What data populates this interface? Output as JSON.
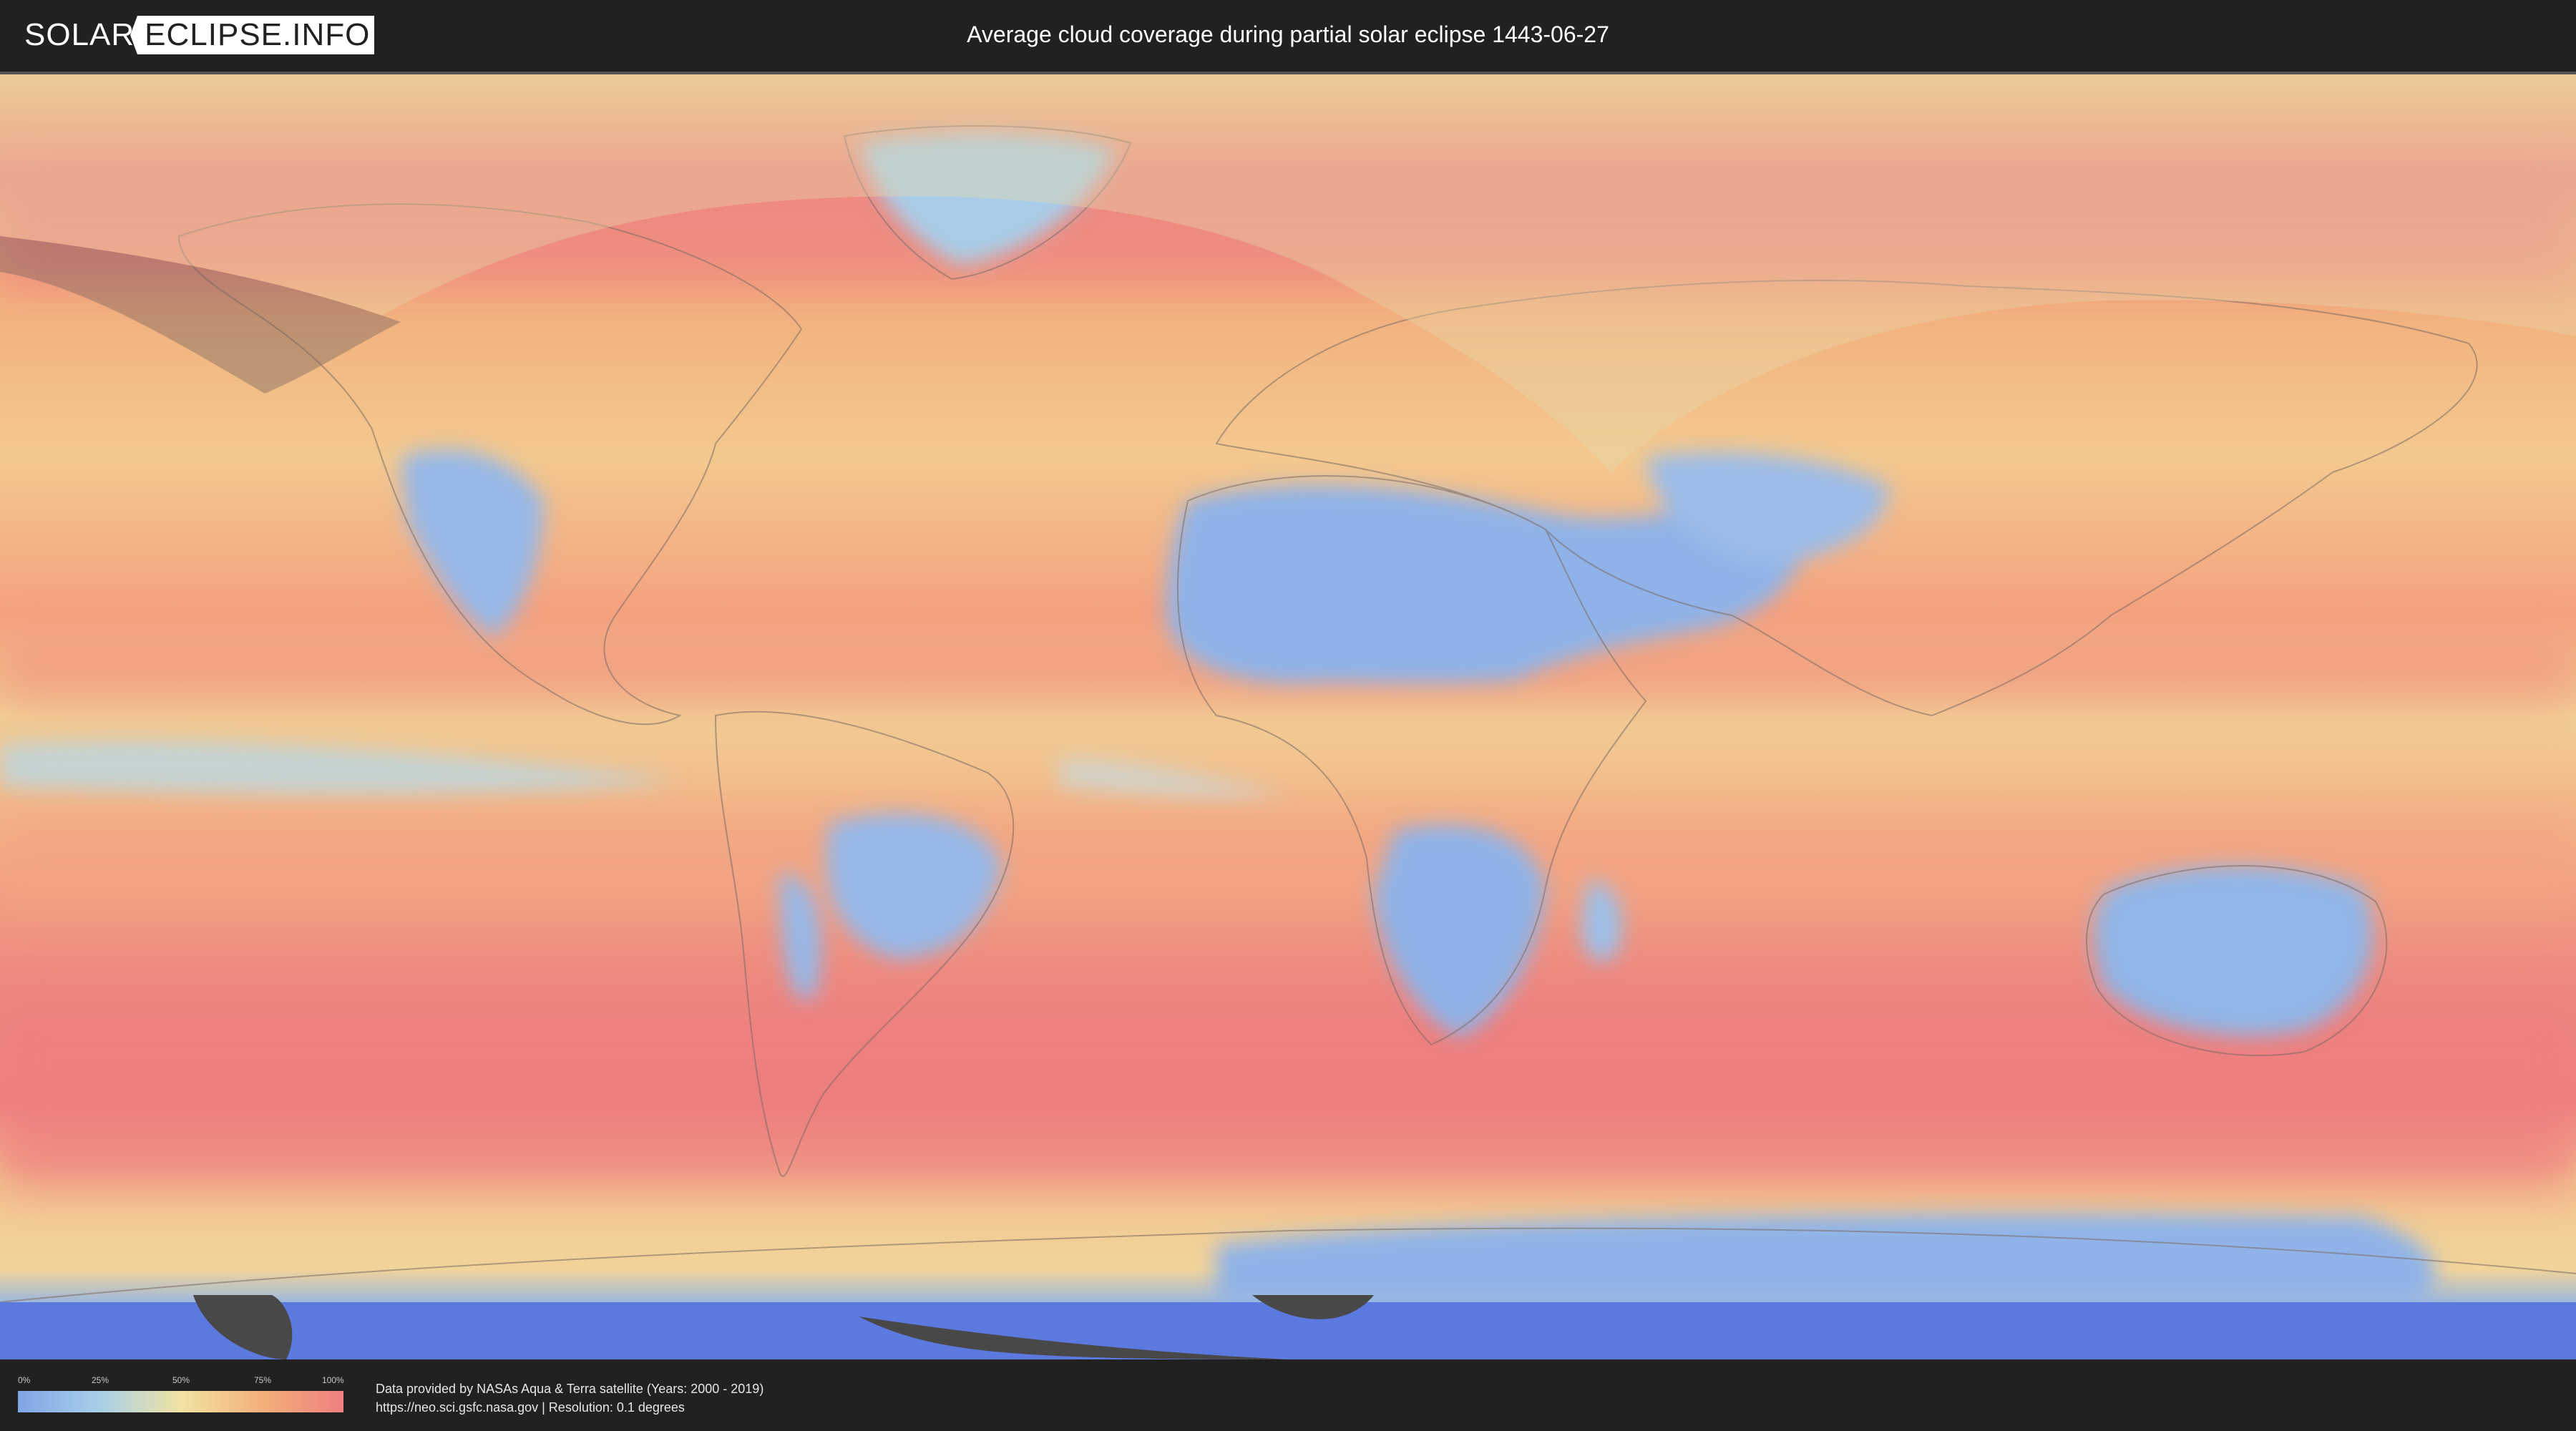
{
  "header": {
    "logo_part1": "SOLAR",
    "logo_part2": "ECLIPSE.INFO",
    "title": "Average cloud coverage during partial solar eclipse 1443-06-27"
  },
  "map": {
    "colors": {
      "cloudy": "#ee7f7f",
      "mid": "#f1e3a3",
      "clear": "#8fb3e8",
      "polar": "#5b79df",
      "eclipse_shade": "#e8d8a8"
    }
  },
  "legend": {
    "ticks": [
      "0%",
      "25%",
      "50%",
      "75%",
      "100%"
    ]
  },
  "credits": {
    "line1": "Data provided by NASAs Aqua & Terra satellite (Years: 2000 - 2019)",
    "line2": "https://neo.sci.gsfc.nasa.gov | Resolution: 0.1 degrees"
  }
}
